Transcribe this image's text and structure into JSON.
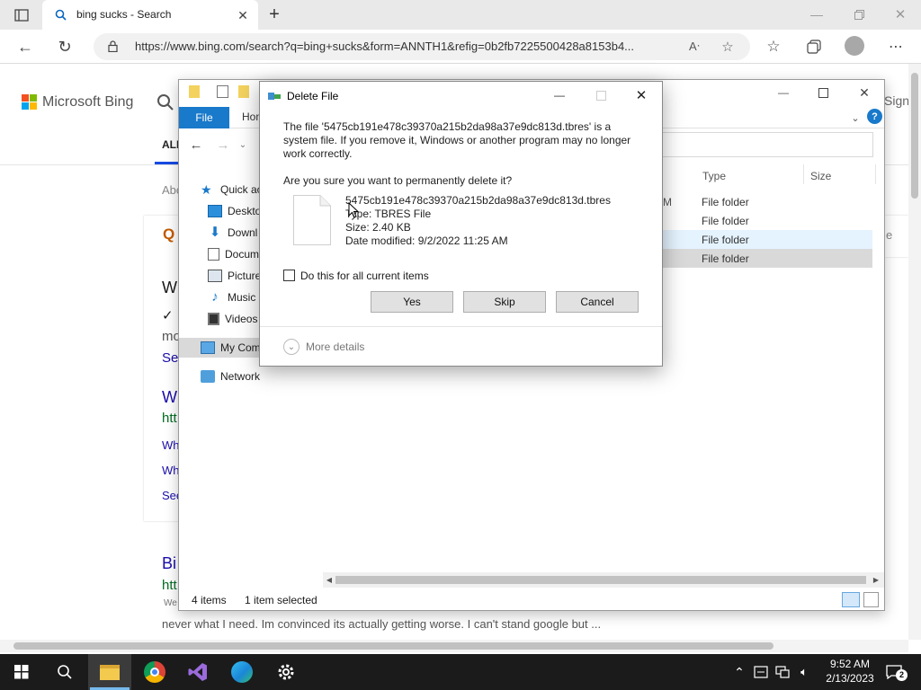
{
  "browser": {
    "tab_title": "bing sucks - Search",
    "url": "https://www.bing.com/search?q=bing+sucks&form=ANNTH1&refig=0b2fb7225500428a8153b4..."
  },
  "bing": {
    "logo_text": "Microsoft Bing",
    "tab_all": "ALL",
    "frag_abo": "Abo",
    "frag_q": "Q",
    "frag_w1": "W",
    "frag_check": "✓ I",
    "frag_mo": "mo",
    "frag_se1": "Se",
    "frag_w2": "W",
    "frag_htt1": "htt",
    "frag_wh1": "Wh",
    "frag_wh2": "Wh",
    "frag_se2": "See",
    "frag_bi": "Bi",
    "frag_htt2": "htt",
    "frag_sign": "Sign",
    "frag_e": "e",
    "snippet_we": "We",
    "snippet": "never what I need. Im convinced its actually getting worse. I can't stand google but ..."
  },
  "explorer": {
    "file_tab": "File",
    "home_tab": "Hom",
    "tree": [
      {
        "label": "Quick ac"
      },
      {
        "label": "Deskto"
      },
      {
        "label": "Downl"
      },
      {
        "label": "Docum"
      },
      {
        "label": "Picture"
      },
      {
        "label": "Music"
      },
      {
        "label": "Videos"
      },
      {
        "label": "My Com"
      },
      {
        "label": "Network"
      }
    ],
    "col_type": "Type",
    "col_size": "Size",
    "row_m": "M",
    "rows": [
      "File folder",
      "File folder",
      "File folder",
      "File folder"
    ],
    "status_items": "4 items",
    "status_selected": "1 item selected"
  },
  "dialog": {
    "title": "Delete File",
    "message": "The file '5475cb191e478c39370a215b2da98a37e9dc813d.tbres' is a system file. If you remove it, Windows or another program may no longer work correctly.",
    "question": "Are you sure you want to permanently delete it?",
    "file_name": "5475cb191e478c39370a215b2da98a37e9dc813d.tbres",
    "file_type": "Type: TBRES File",
    "file_size": "Size: 2.40 KB",
    "file_modified": "Date modified: 9/2/2022 11:25 AM",
    "checkbox_label": "Do this for all current items",
    "yes_label": "Yes",
    "skip_label": "Skip",
    "cancel_label": "Cancel",
    "more_details": "More details"
  },
  "taskbar": {
    "time": "9:52 AM",
    "date": "2/13/2023",
    "notification_count": "2"
  },
  "colors": {
    "accent": "#1979ca",
    "taskbar": "#1b1b1b",
    "selection": "#cce8ff"
  }
}
